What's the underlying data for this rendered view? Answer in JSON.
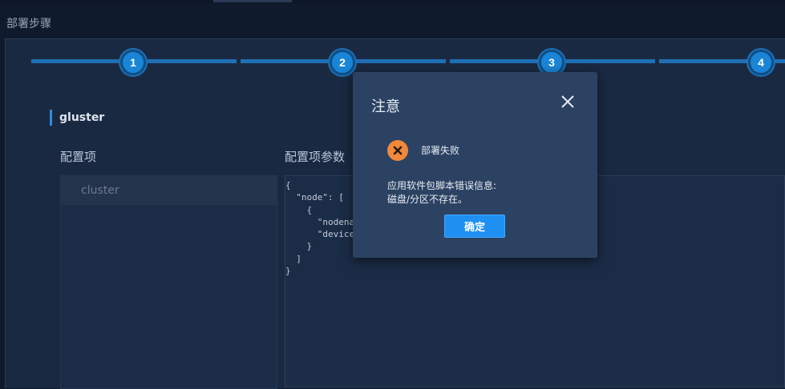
{
  "header": {
    "title": "部署步骤"
  },
  "stepper": {
    "steps": [
      "1",
      "2",
      "3",
      "4"
    ]
  },
  "section": {
    "title": "gluster"
  },
  "config": {
    "items_label": "配置项",
    "params_label": "配置项参数",
    "items": [
      "cluster"
    ]
  },
  "editor": {
    "lines": [
      "{",
      "  \"node\": [",
      "    {",
      "      \"nodenan",
      "      \"device\": [",
      "    }",
      "  ]",
      "}"
    ]
  },
  "modal": {
    "title": "注意",
    "status": "部署失败",
    "message_label": "应用软件包脚本错误信息:",
    "message_detail": "磁盘/分区不存在。",
    "confirm_label": "确定"
  },
  "colors": {
    "accent": "#1e90f2",
    "error": "#f0893a",
    "step_line": "#1f6fb5"
  }
}
